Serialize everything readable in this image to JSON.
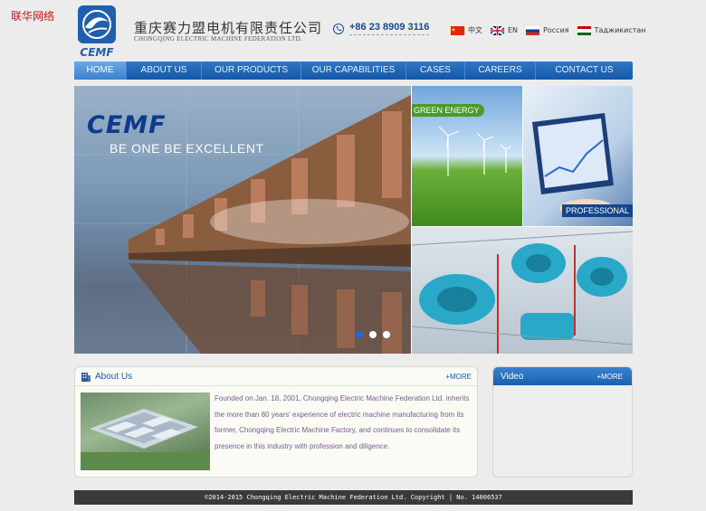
{
  "watermark": "联华网络",
  "header": {
    "logo_text": "CEMF",
    "company_cn": "重庆赛力盟电机有限责任公司",
    "company_en": "CHONGQING ELECTRIC MACHINE FEDERATION LTD.",
    "phone": "+86 23 8909 3116",
    "phone_icon": "phone-icon",
    "languages": [
      {
        "label": "中文",
        "flag": "china-flag-icon"
      },
      {
        "label": "EN",
        "flag": "uk-flag-icon"
      },
      {
        "label": "Россия",
        "flag": "russia-flag-icon"
      },
      {
        "label": "Таджикистан",
        "flag": "tajikistan-flag-icon"
      }
    ]
  },
  "nav": {
    "items": [
      {
        "label": "HOME",
        "active": true
      },
      {
        "label": "ABOUT US",
        "active": false
      },
      {
        "label": "OUR PRODUCTS",
        "active": false
      },
      {
        "label": "OUR CAPABILITIES",
        "active": false
      },
      {
        "label": "CASES",
        "active": false
      },
      {
        "label": "CAREERS",
        "active": false
      },
      {
        "label": "CONTACT US",
        "active": false
      }
    ],
    "color": "#1f66b5"
  },
  "banner": {
    "brand": "CEMF",
    "tagline": "BE ONE  BE EXCELLENT",
    "green_label": "GREEN ENERGY",
    "prof_label": "PROFESSIONAL",
    "slide_count": 3,
    "active_slide": 0
  },
  "about": {
    "title": "About Us",
    "more": "+MORE",
    "text": "Founded on Jan. 18, 2001, Chongqing Electric Machine Federation Ltd. inherits the more than 80 years' experience of electric machine manufacturing from its former, Chongqing Electric Machine Factory, and continues to consolidate its presence in this industry with profession and diligence."
  },
  "video": {
    "title": "Video",
    "more": "+MORE"
  },
  "footer": {
    "text": "©2014-2015 Chongqing Electric Machine Federation Ltd. Copyright | No. 14006537"
  }
}
